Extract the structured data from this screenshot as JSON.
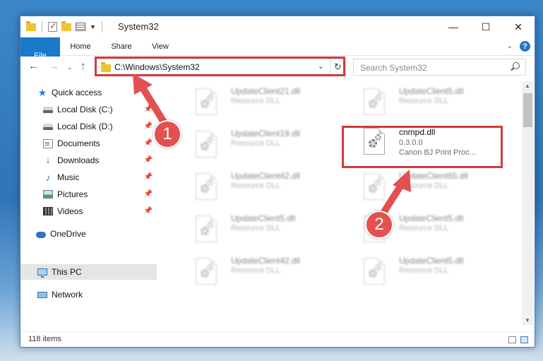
{
  "window": {
    "title": "System32"
  },
  "ribbon": {
    "tabs": [
      {
        "label": "File"
      },
      {
        "label": "Home"
      },
      {
        "label": "Share"
      },
      {
        "label": "View"
      }
    ],
    "help": "?"
  },
  "address": {
    "path": "C:\\Windows\\System32"
  },
  "search": {
    "placeholder": "Search System32"
  },
  "nav_pane": {
    "items": [
      {
        "label": "Quick access",
        "icon": "star-icon"
      },
      {
        "label": "Local Disk (C:)",
        "icon": "drive-icon",
        "pinned": true
      },
      {
        "label": "Local Disk (D:)",
        "icon": "drive-icon",
        "pinned": true
      },
      {
        "label": "Documents",
        "icon": "documents-icon",
        "pinned": true
      },
      {
        "label": "Downloads",
        "icon": "download-icon",
        "pinned": true
      },
      {
        "label": "Music",
        "icon": "music-icon",
        "pinned": true
      },
      {
        "label": "Pictures",
        "icon": "pictures-icon",
        "pinned": true
      },
      {
        "label": "Videos",
        "icon": "videos-icon",
        "pinned": true
      },
      {
        "label": "OneDrive",
        "icon": "cloud-icon"
      },
      {
        "label": "This PC",
        "icon": "computer-icon",
        "selected": true
      },
      {
        "label": "Network",
        "icon": "network-icon"
      }
    ]
  },
  "files": [
    {
      "name": "UpdateClient21.dll",
      "desc": "Resource DLL"
    },
    {
      "name": "UpdateClient5.dll",
      "desc": "Resource DLL"
    },
    {
      "name": "UpdateClient19.dll",
      "desc": "Resource DLL"
    },
    {
      "name": "cnmpd.dll",
      "version": "0.3.0.0",
      "desc": "Canon BJ Print Proc..."
    },
    {
      "name": "UpdateClient42.dll",
      "desc": "Resource DLL"
    },
    {
      "name": "UpdateClient65.dll",
      "desc": "Resource DLL"
    },
    {
      "name": "UpdateClient5.dll",
      "desc": "Resource DLL"
    },
    {
      "name": "UpdateClient5.dll",
      "desc": "Resource DLL"
    },
    {
      "name": "UpdateClient42.dll",
      "desc": "Resource DLL"
    },
    {
      "name": "UpdateClient5.dll",
      "desc": "Resource DLL"
    }
  ],
  "status": {
    "item_count": "118 items"
  },
  "annotations": [
    {
      "label": "1"
    },
    {
      "label": "2"
    }
  ],
  "colors": {
    "accent": "#1979ca",
    "highlight": "#d23a3a",
    "badge": "#e45050",
    "selection": "#e5e5e5"
  }
}
